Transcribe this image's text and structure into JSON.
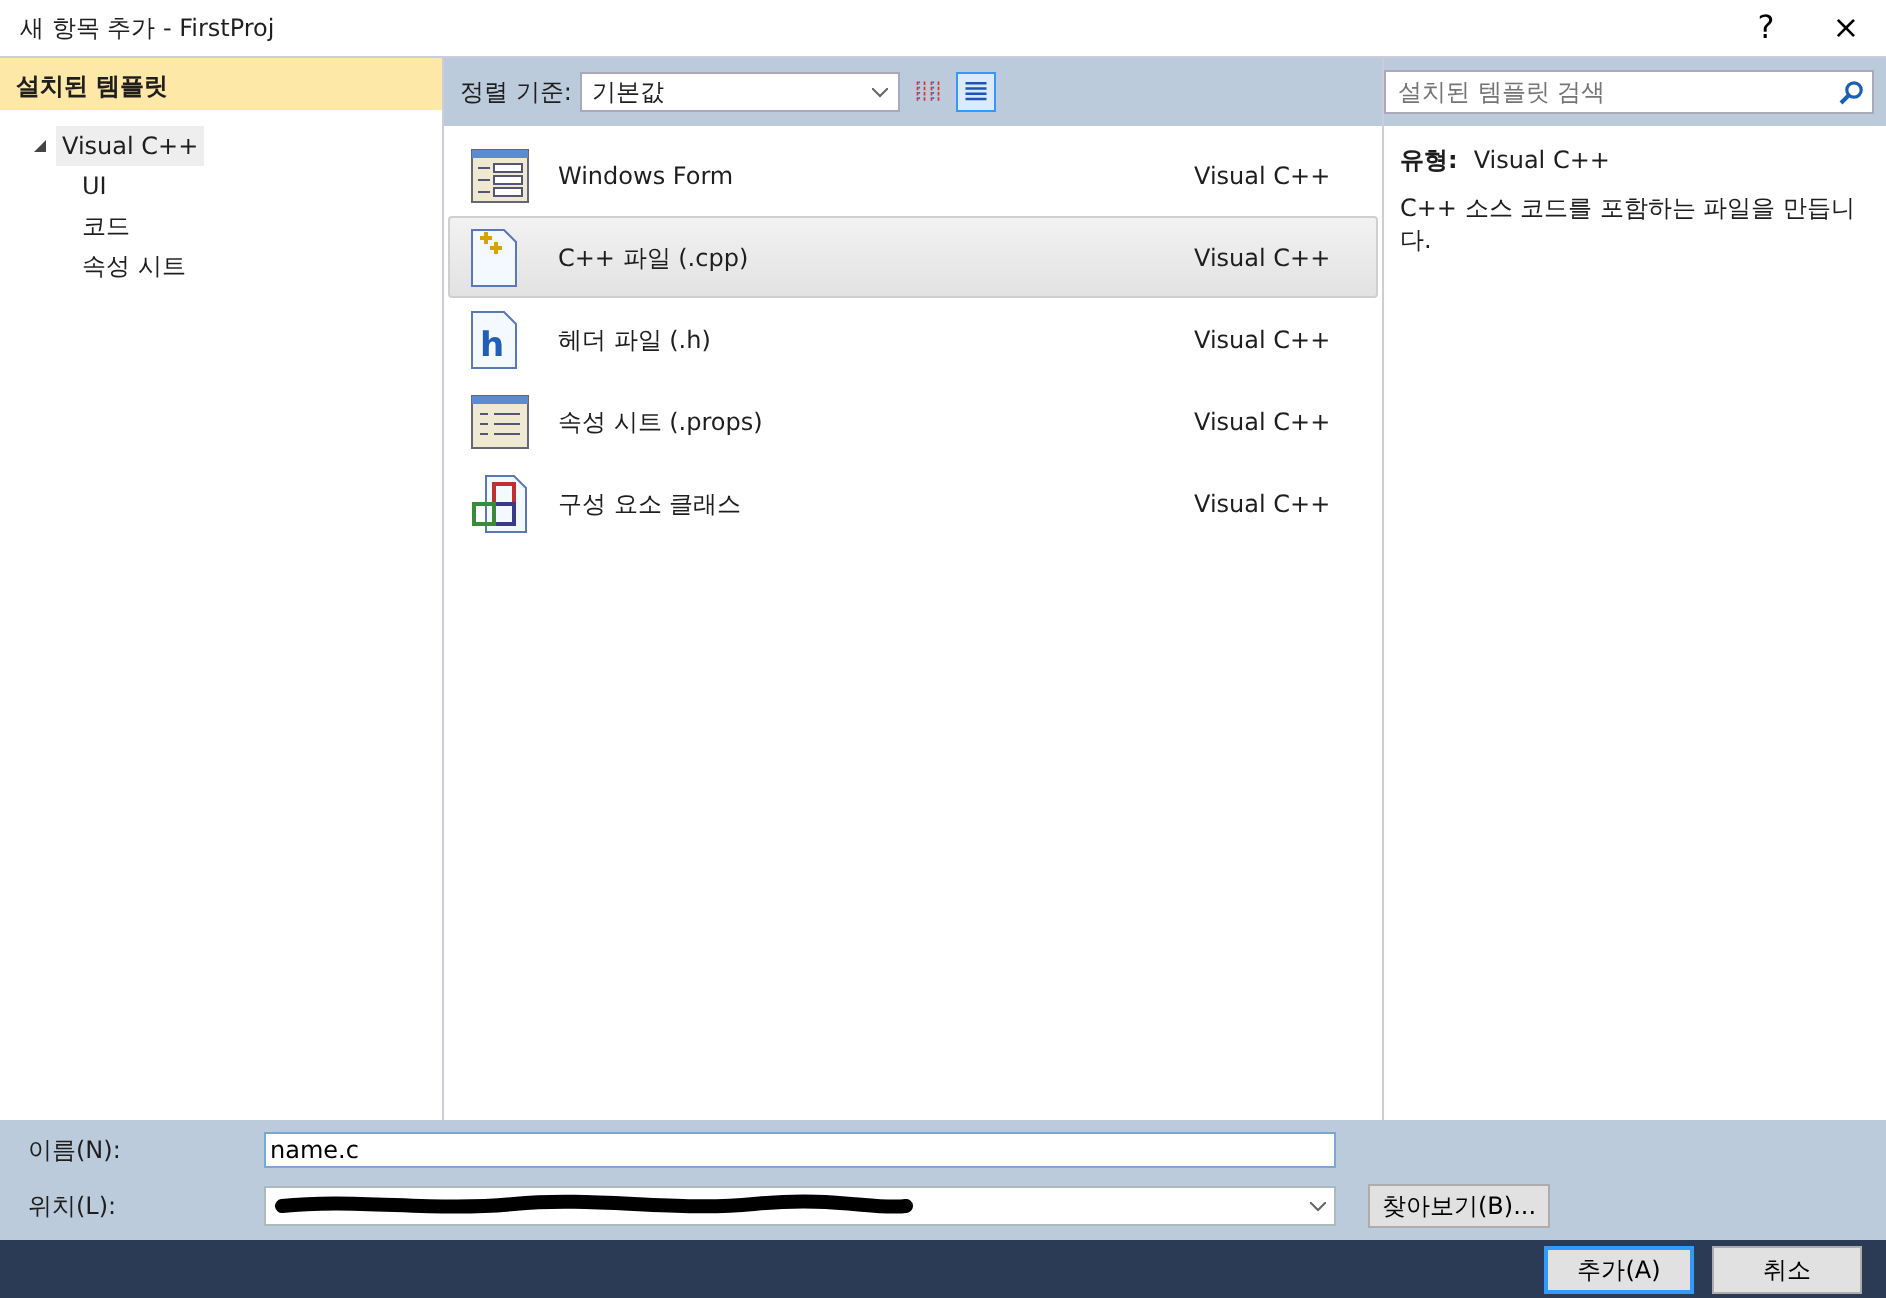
{
  "window": {
    "title": "새 항목 추가 - FirstProj",
    "help": "?",
    "close": "×"
  },
  "sidebar": {
    "title": "설치된 템플릿",
    "tree": [
      {
        "label": "Visual C++",
        "expanded": true,
        "selected": true,
        "children": [
          {
            "label": "UI",
            "selected": false
          },
          {
            "label": "코드",
            "selected": false
          },
          {
            "label": "속성 시트",
            "selected": false
          }
        ]
      }
    ]
  },
  "toolbar": {
    "sort_label": "정렬 기준:",
    "sort_value": "기본값",
    "views": [
      {
        "kind": "small",
        "selected": false
      },
      {
        "kind": "list",
        "selected": true
      }
    ],
    "search": {
      "placeholder": "설치된 템플릿 검색"
    }
  },
  "templates": [
    {
      "kind": "form",
      "name": "Windows Form",
      "type": "Visual C++",
      "selected": false
    },
    {
      "kind": "cpp",
      "name": "C++ 파일 (.cpp)",
      "type": "Visual C++",
      "selected": true
    },
    {
      "kind": "header",
      "icon_letter": "h",
      "name": "헤더 파일 (.h)",
      "type": "Visual C++",
      "selected": false
    },
    {
      "kind": "props",
      "name": "속성 시트 (.props)",
      "type": "Visual C++",
      "selected": false
    },
    {
      "kind": "component",
      "name": "구성 요소 클래스",
      "type": "Visual C++",
      "selected": false
    }
  ],
  "details": {
    "type_label": "유형:",
    "type_value": "Visual C++",
    "description": "C++ 소스 코드를 포함하는 파일을 만듭니다."
  },
  "form": {
    "name_label": "이름(N):",
    "name_value": "name.c",
    "location_label": "위치(L):",
    "location_redacted": true,
    "browse": "찾아보기(B)..."
  },
  "buttons": [
    {
      "label": "추가(A)",
      "default": true
    },
    {
      "label": "취소",
      "default": false
    }
  ]
}
